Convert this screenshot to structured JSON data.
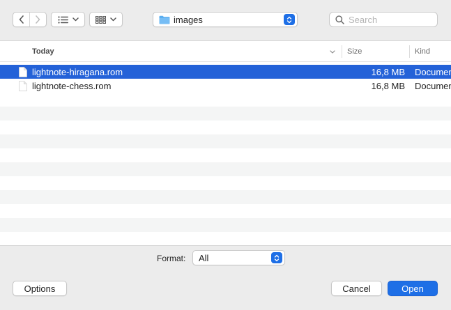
{
  "toolbar": {
    "back_icon": "chevron-left-icon",
    "forward_icon": "chevron-right-icon",
    "list_view_icon": "list-icon",
    "grid_view_icon": "grid-icon",
    "location": "images",
    "search_placeholder": "Search"
  },
  "columns": {
    "name": "Today",
    "size": "Size",
    "kind": "Kind"
  },
  "files": [
    {
      "name": "lightnote-hiragana.rom",
      "size": "16,8 MB",
      "kind": "Document",
      "selected": true
    },
    {
      "name": "lightnote-chess.rom",
      "size": "16,8 MB",
      "kind": "Document",
      "selected": false
    }
  ],
  "format": {
    "label": "Format:",
    "value": "All"
  },
  "buttons": {
    "options": "Options",
    "cancel": "Cancel",
    "open": "Open"
  },
  "colors": {
    "accent": "#1e6fe6",
    "selection": "#2462d8"
  }
}
